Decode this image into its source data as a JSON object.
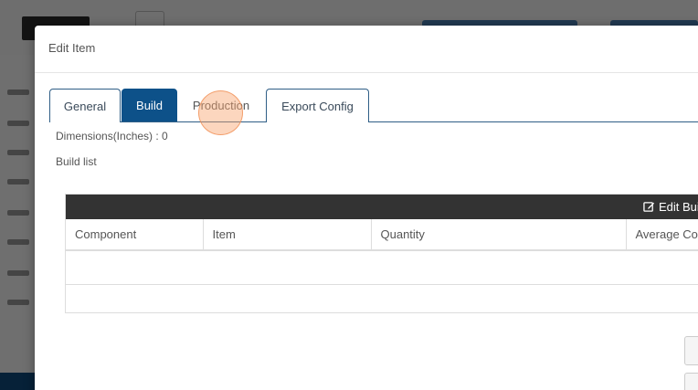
{
  "modal": {
    "title": "Edit Item"
  },
  "tabs": [
    {
      "label": "General",
      "active": false
    },
    {
      "label": "Build",
      "active": true
    },
    {
      "label": "Production",
      "active": false
    },
    {
      "label": "Export Config",
      "active": false
    }
  ],
  "info": {
    "dimensions": "Dimensions(Inches) : 0",
    "build_list": "Build list"
  },
  "build_table": {
    "edit_label": "Edit Buil",
    "columns": [
      "Component",
      "Item",
      "Quantity",
      "Average Co"
    ]
  },
  "colors": {
    "active_tab": "#0d5189",
    "panel_bar": "#333333",
    "click_indicator": "#f9a56e"
  }
}
